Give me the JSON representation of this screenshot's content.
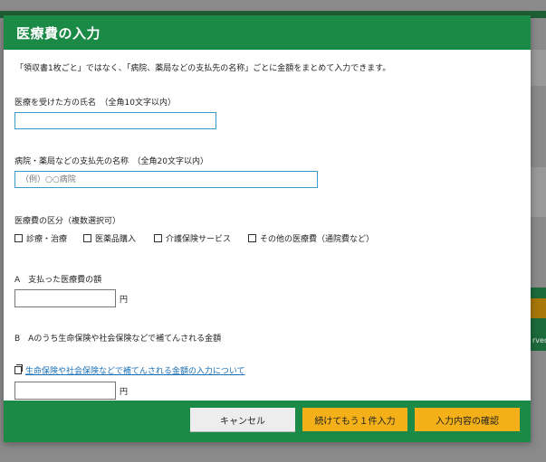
{
  "dialog": {
    "title": "医療費の入力",
    "intro": "「領収書1枚ごと」ではなく、「病院、薬局などの支払先の名称」ごとに金額をまとめて入力できます。",
    "patient_name": {
      "label": "医療を受けた方の氏名　（全角10文字以内）",
      "value": "",
      "placeholder": ""
    },
    "provider_name": {
      "label": "病院・薬局などの支払先の名称　（全角20文字以内）",
      "value": "",
      "placeholder": "（例）○○病院"
    },
    "category": {
      "label": "医療費の区分（複数選択可）",
      "options": [
        {
          "label": "診療・治療",
          "checked": false
        },
        {
          "label": "医薬品購入",
          "checked": false
        },
        {
          "label": "介護保険サービス",
          "checked": false
        },
        {
          "label": "その他の医療費（通院費など）",
          "checked": false
        }
      ]
    },
    "amount_paid": {
      "label": "A　支払った医療費の額",
      "value": "",
      "unit": "円"
    },
    "reimbursed": {
      "label": "B　Aのうち生命保険や社会保険などで補てんされる金額",
      "help_link": "生命保険や社会保険などで補てんされる金額の入力について",
      "value": "",
      "unit": "円"
    },
    "buttons": {
      "cancel": "キャンセル",
      "continue": "続けてもう１件入力",
      "confirm": "入力内容の確認"
    }
  },
  "background": {
    "fragment_text": "rved"
  },
  "colors": {
    "header_green": "#1b8a47",
    "button_orange": "#f3b018",
    "input_border_blue": "#3b9ac9",
    "link_blue": "#1a6fb5"
  }
}
